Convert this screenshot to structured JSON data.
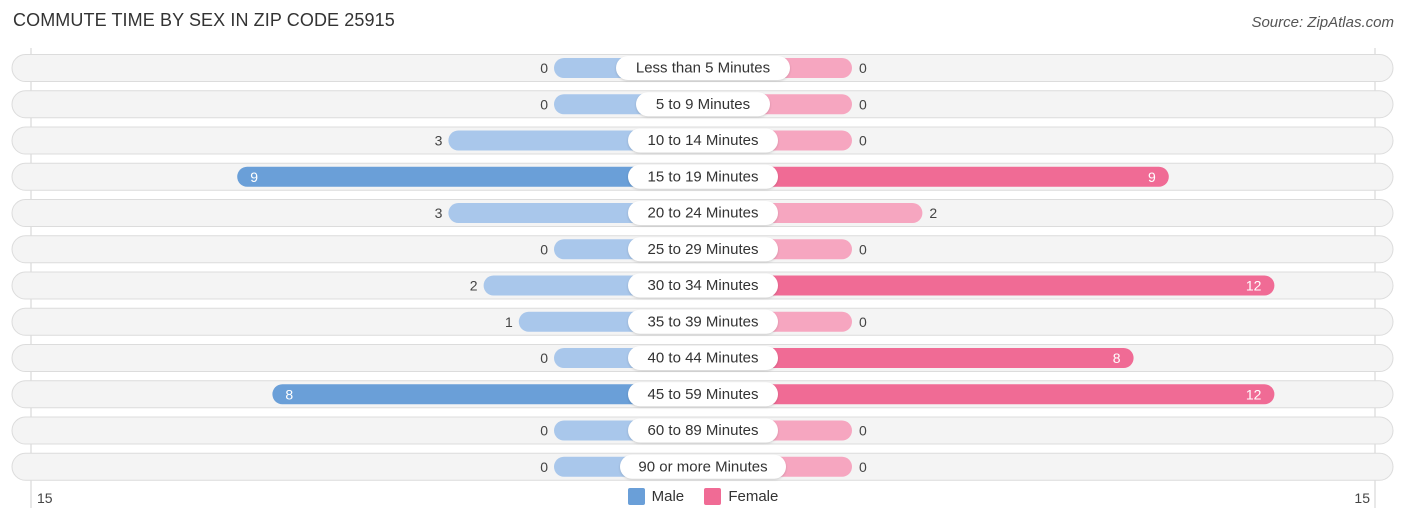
{
  "header": {
    "title": "COMMUTE TIME BY SEX IN ZIP CODE 25915",
    "source": "Source: ZipAtlas.com"
  },
  "colors": {
    "male_strong": "#6a9fd8",
    "male_light": "#a9c7eb",
    "female_strong": "#f06b95",
    "female_light": "#f6a6c0"
  },
  "chart_data": {
    "type": "bar",
    "orientation": "horizontal-diverging",
    "title": "COMMUTE TIME BY SEX IN ZIP CODE 25915",
    "categories": [
      "Less than 5 Minutes",
      "5 to 9 Minutes",
      "10 to 14 Minutes",
      "15 to 19 Minutes",
      "20 to 24 Minutes",
      "25 to 29 Minutes",
      "30 to 34 Minutes",
      "35 to 39 Minutes",
      "40 to 44 Minutes",
      "45 to 59 Minutes",
      "60 to 89 Minutes",
      "90 or more Minutes"
    ],
    "series": [
      {
        "name": "Male",
        "side": "left",
        "values": [
          0,
          0,
          3,
          9,
          3,
          0,
          2,
          1,
          0,
          8,
          0,
          0
        ]
      },
      {
        "name": "Female",
        "side": "right",
        "values": [
          0,
          0,
          0,
          9,
          2,
          0,
          12,
          0,
          8,
          12,
          0,
          0
        ]
      }
    ],
    "axis": {
      "left_tick_label": "15",
      "right_tick_label": "15",
      "range": [
        -15,
        15
      ]
    },
    "legend": {
      "position": "bottom-center",
      "entries": [
        "Male",
        "Female"
      ]
    },
    "grid": false
  }
}
